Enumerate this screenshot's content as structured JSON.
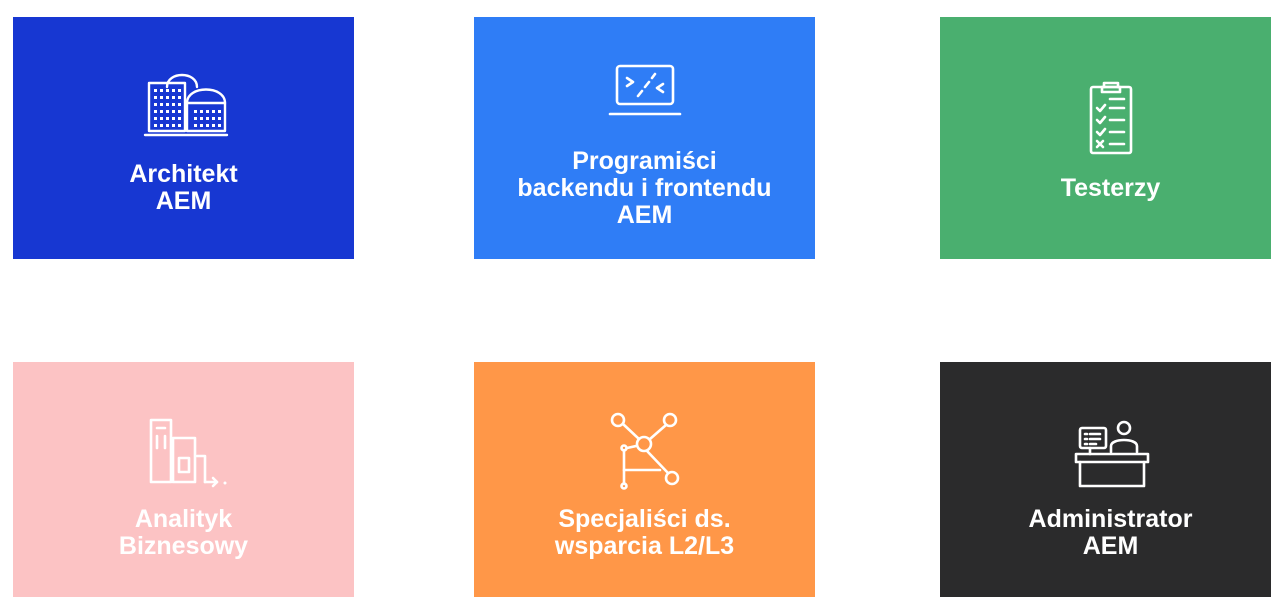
{
  "tiles": [
    {
      "label": "Architekt\nAEM",
      "icon": "buildings-icon",
      "background": "#1737d2",
      "text_color": "#ffffff"
    },
    {
      "label": "Programiści\nbackendu i frontendu\nAEM",
      "icon": "code-screen-icon",
      "background": "#2f7df6",
      "text_color": "#ffffff"
    },
    {
      "label": "Testerzy",
      "icon": "checklist-clipboard-icon",
      "background": "#4aaf6f",
      "text_color": "#ffffff"
    },
    {
      "label": "Analityk\nBiznesowy",
      "icon": "business-buildings-icon",
      "background": "#fcc3c4",
      "text_color": "#ffffff"
    },
    {
      "label": "Specjaliści ds.\nwsparcia L2/L3",
      "icon": "network-nodes-icon",
      "background": "#ff9748",
      "text_color": "#ffffff"
    },
    {
      "label": "Administrator\nAEM",
      "icon": "admin-desk-icon",
      "background": "#2b2b2c",
      "text_color": "#ffffff"
    }
  ]
}
